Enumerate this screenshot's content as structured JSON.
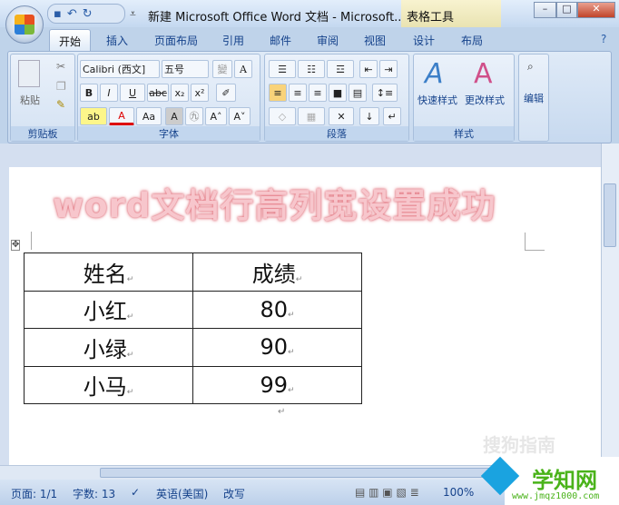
{
  "title": "新建 Microsoft Office Word 文档 - Microsoft...",
  "contextual_tab": "表格工具",
  "tabs": [
    "开始",
    "插入",
    "页面布局",
    "引用",
    "邮件",
    "审阅",
    "视图",
    "设计",
    "布局"
  ],
  "ribbon": {
    "clipboard": {
      "label": "剪贴板",
      "paste": "粘贴"
    },
    "font": {
      "label": "字体",
      "font_name": "Calibri (西文]",
      "font_size": "五号",
      "bold": "B",
      "italic": "I",
      "underline": "U",
      "strike": "abc",
      "sub": "x₂",
      "sup": "x²",
      "grow": "A˄",
      "shrink": "A˅",
      "change_case": "Aa"
    },
    "paragraph": {
      "label": "段落"
    },
    "styles": {
      "label": "样式",
      "quick": "快速样式",
      "change": "更改样式"
    },
    "editing": {
      "label": "编辑"
    }
  },
  "overlay_text": "word文档行高列宽设置成功",
  "table": [
    [
      "姓名",
      "成绩"
    ],
    [
      "小红",
      "80"
    ],
    [
      "小绿",
      "90"
    ],
    [
      "小马",
      "99"
    ]
  ],
  "status": {
    "page": "页面: 1/1",
    "words": "字数: 13",
    "language": "英语(美国)",
    "mode": "改写",
    "zoom": "100%"
  },
  "watermark": {
    "site": "搜狗指南",
    "logo": "学知网",
    "url": "www.jmqz1000.com"
  }
}
